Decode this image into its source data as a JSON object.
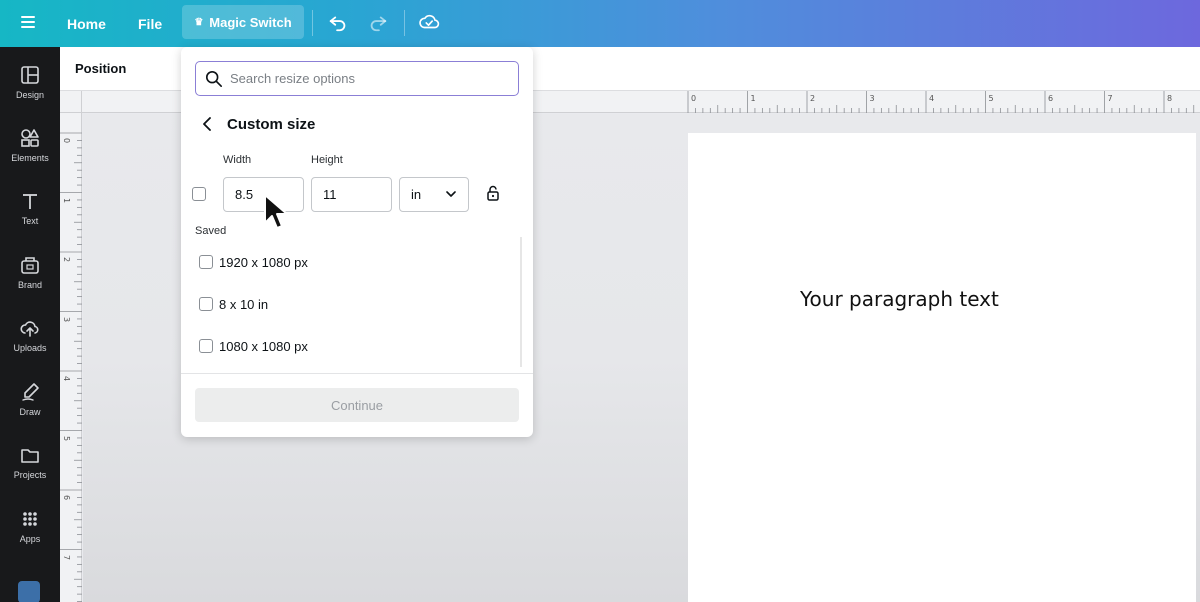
{
  "topbar": {
    "home_label": "Home",
    "file_label": "File",
    "magic_switch_label": "Magic Switch",
    "icons": [
      "menu-icon",
      "crown-icon",
      "undo-icon",
      "redo-icon",
      "cloud-saved-icon"
    ]
  },
  "sidebar": {
    "items": [
      {
        "label": "Design",
        "icon": "layout-icon"
      },
      {
        "label": "Elements",
        "icon": "shapes-icon"
      },
      {
        "label": "Text",
        "icon": "text-icon"
      },
      {
        "label": "Brand",
        "icon": "brand-icon"
      },
      {
        "label": "Uploads",
        "icon": "upload-cloud-icon"
      },
      {
        "label": "Draw",
        "icon": "pen-icon"
      },
      {
        "label": "Projects",
        "icon": "folder-icon"
      },
      {
        "label": "Apps",
        "icon": "apps-grid-icon"
      }
    ]
  },
  "position_bar": {
    "label": "Position"
  },
  "ruler": {
    "top_numbers": [
      "0",
      "1",
      "2",
      "3",
      "4",
      "5",
      "6",
      "7",
      "8"
    ],
    "left_numbers": [
      "0",
      "1",
      "2",
      "3",
      "4",
      "5",
      "6",
      "7"
    ]
  },
  "resize_panel": {
    "search_placeholder": "Search resize options",
    "title": "Custom size",
    "width_label": "Width",
    "height_label": "Height",
    "width_value": "8.5",
    "height_value": "11",
    "unit_value": "in",
    "saved_label": "Saved",
    "saved_items": [
      "1920 x 1080 px",
      "8 x 10 in",
      "1080 x 1080 px"
    ],
    "continue_label": "Continue"
  },
  "canvas": {
    "paragraph_text": "Your paragraph text"
  }
}
